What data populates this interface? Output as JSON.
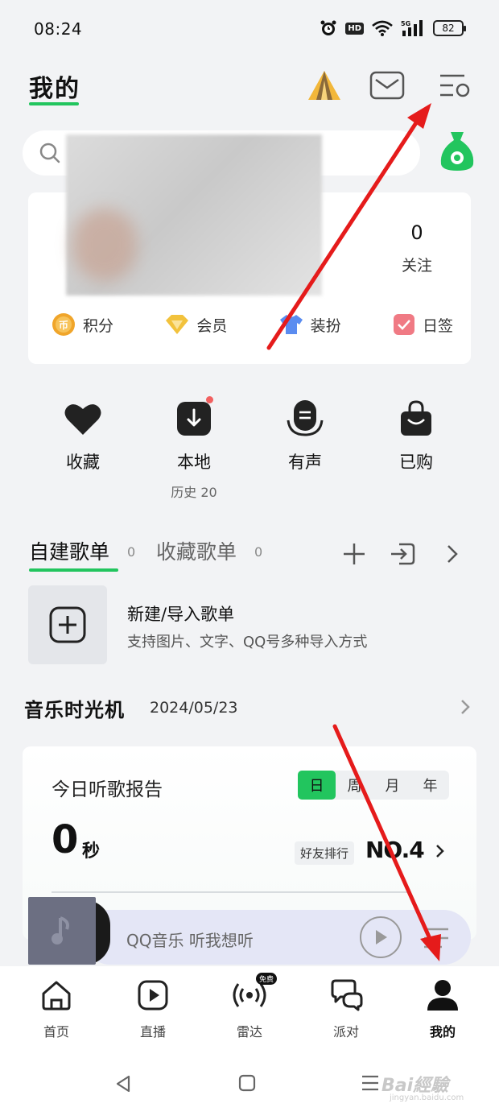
{
  "status_bar": {
    "time": "08:24",
    "hd": "HD",
    "network": "5G",
    "battery": "82"
  },
  "header": {
    "title": "我的",
    "icons": [
      "tent-icon",
      "mail-icon",
      "settings-menu-icon"
    ]
  },
  "search": {
    "placeholder": "",
    "bag_icon": "money-bag-icon"
  },
  "profile": {
    "follow_count": "0",
    "follow_label": "关注",
    "quick_links": [
      {
        "label": "积分",
        "icon": "points-coin-icon",
        "color": "#f0a52a"
      },
      {
        "label": "会员",
        "icon": "diamond-icon",
        "color": "#f2c23c"
      },
      {
        "label": "装扮",
        "icon": "shirt-icon",
        "color": "#5a8cf0"
      },
      {
        "label": "日签",
        "icon": "checkin-icon",
        "color": "#f07a84"
      }
    ]
  },
  "shortcuts": [
    {
      "label": "收藏",
      "sub": "",
      "icon": "heart-icon"
    },
    {
      "label": "本地",
      "sub": "历史 20",
      "icon": "download-icon"
    },
    {
      "label": "有声",
      "sub": "",
      "icon": "podcast-icon"
    },
    {
      "label": "已购",
      "sub": "",
      "icon": "shopping-bag-icon"
    }
  ],
  "playlists": {
    "tab_created": "自建歌单",
    "tab_created_count": "0",
    "tab_collected": "收藏歌单",
    "tab_collected_count": "0",
    "new_title": "新建/导入歌单",
    "new_subtitle": "支持图片、文字、QQ号多种导入方式"
  },
  "time_machine": {
    "title": "音乐时光机",
    "date": "2024/05/23"
  },
  "report": {
    "title": "今日听歌报告",
    "periods": [
      "日",
      "周",
      "月",
      "年"
    ],
    "active_period": "日",
    "listen_value": "0",
    "listen_unit": "秒",
    "rank_label": "好友排行",
    "rank_value": "NO.4"
  },
  "mini_player": {
    "text": "QQ音乐 听我想听"
  },
  "bottom_nav": [
    {
      "label": "首页",
      "icon": "home-icon",
      "active": false
    },
    {
      "label": "直播",
      "icon": "live-play-icon",
      "active": false
    },
    {
      "label": "雷达",
      "icon": "radar-icon",
      "active": false,
      "badge": "免费"
    },
    {
      "label": "派对",
      "icon": "chat-bubbles-icon",
      "active": false
    },
    {
      "label": "我的",
      "icon": "profile-icon",
      "active": true
    }
  ],
  "watermark": {
    "text": "Bai經驗",
    "sub": "jingyan.baidu.com"
  },
  "colors": {
    "accent": "#22c55e",
    "arrow": "#e51b1b",
    "background": "#f2f3f5"
  }
}
